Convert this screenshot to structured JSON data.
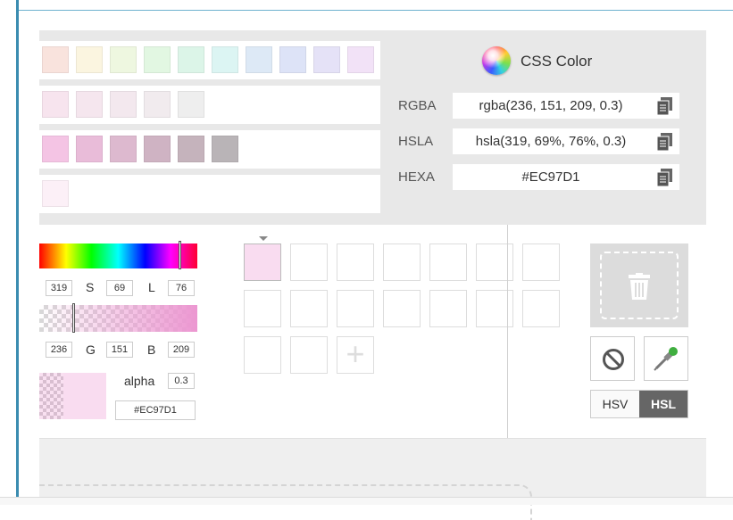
{
  "app": {
    "title": "CSS Color"
  },
  "swatches": {
    "row1": [
      "#f9e3dd",
      "#fbf5e0",
      "#eef7e0",
      "#e2f7e2",
      "#dcf5e8",
      "#dcf5f3",
      "#dde9f6",
      "#dde3f7",
      "#e5e2f7",
      "#f2e2f7"
    ],
    "row2": [
      "#f7e4ee",
      "#f5e6ee",
      "#f3e8ee",
      "#f1ebee",
      "#eeeeee"
    ],
    "row3": [
      "#f4c4e4",
      "#e9bcd9",
      "#ddb9cf",
      "#cfb3c3",
      "#c5b3bc",
      "#b9b4b7"
    ],
    "row4": [
      "#fcf0f7"
    ]
  },
  "formats": {
    "rgba": {
      "label": "RGBA",
      "value": "rgba(236, 151, 209, 0.3)"
    },
    "hsla": {
      "label": "HSLA",
      "value": "hsla(319, 69%, 76%, 0.3)"
    },
    "hexa": {
      "label": "HEXA",
      "value": "#EC97D1"
    }
  },
  "picker": {
    "hue_value": "319",
    "s_label": "S",
    "s_value": "69",
    "l_label": "L",
    "l_value": "76",
    "r_value": "236",
    "g_label": "G",
    "g_value": "151",
    "b_label": "B",
    "b_value": "209",
    "alpha_label": "alpha",
    "alpha_value": "0.3",
    "hex_value": "#EC97D1",
    "hue_position": 0.886,
    "alpha_position": 0.3
  },
  "saved_colors": [
    "#f9dcf0"
  ],
  "mode_toggle": {
    "hsv": "HSV",
    "hsl": "HSL",
    "active": "HSL"
  },
  "colors": {
    "accent": "#3a8cb0",
    "current": "#EC97D1"
  }
}
